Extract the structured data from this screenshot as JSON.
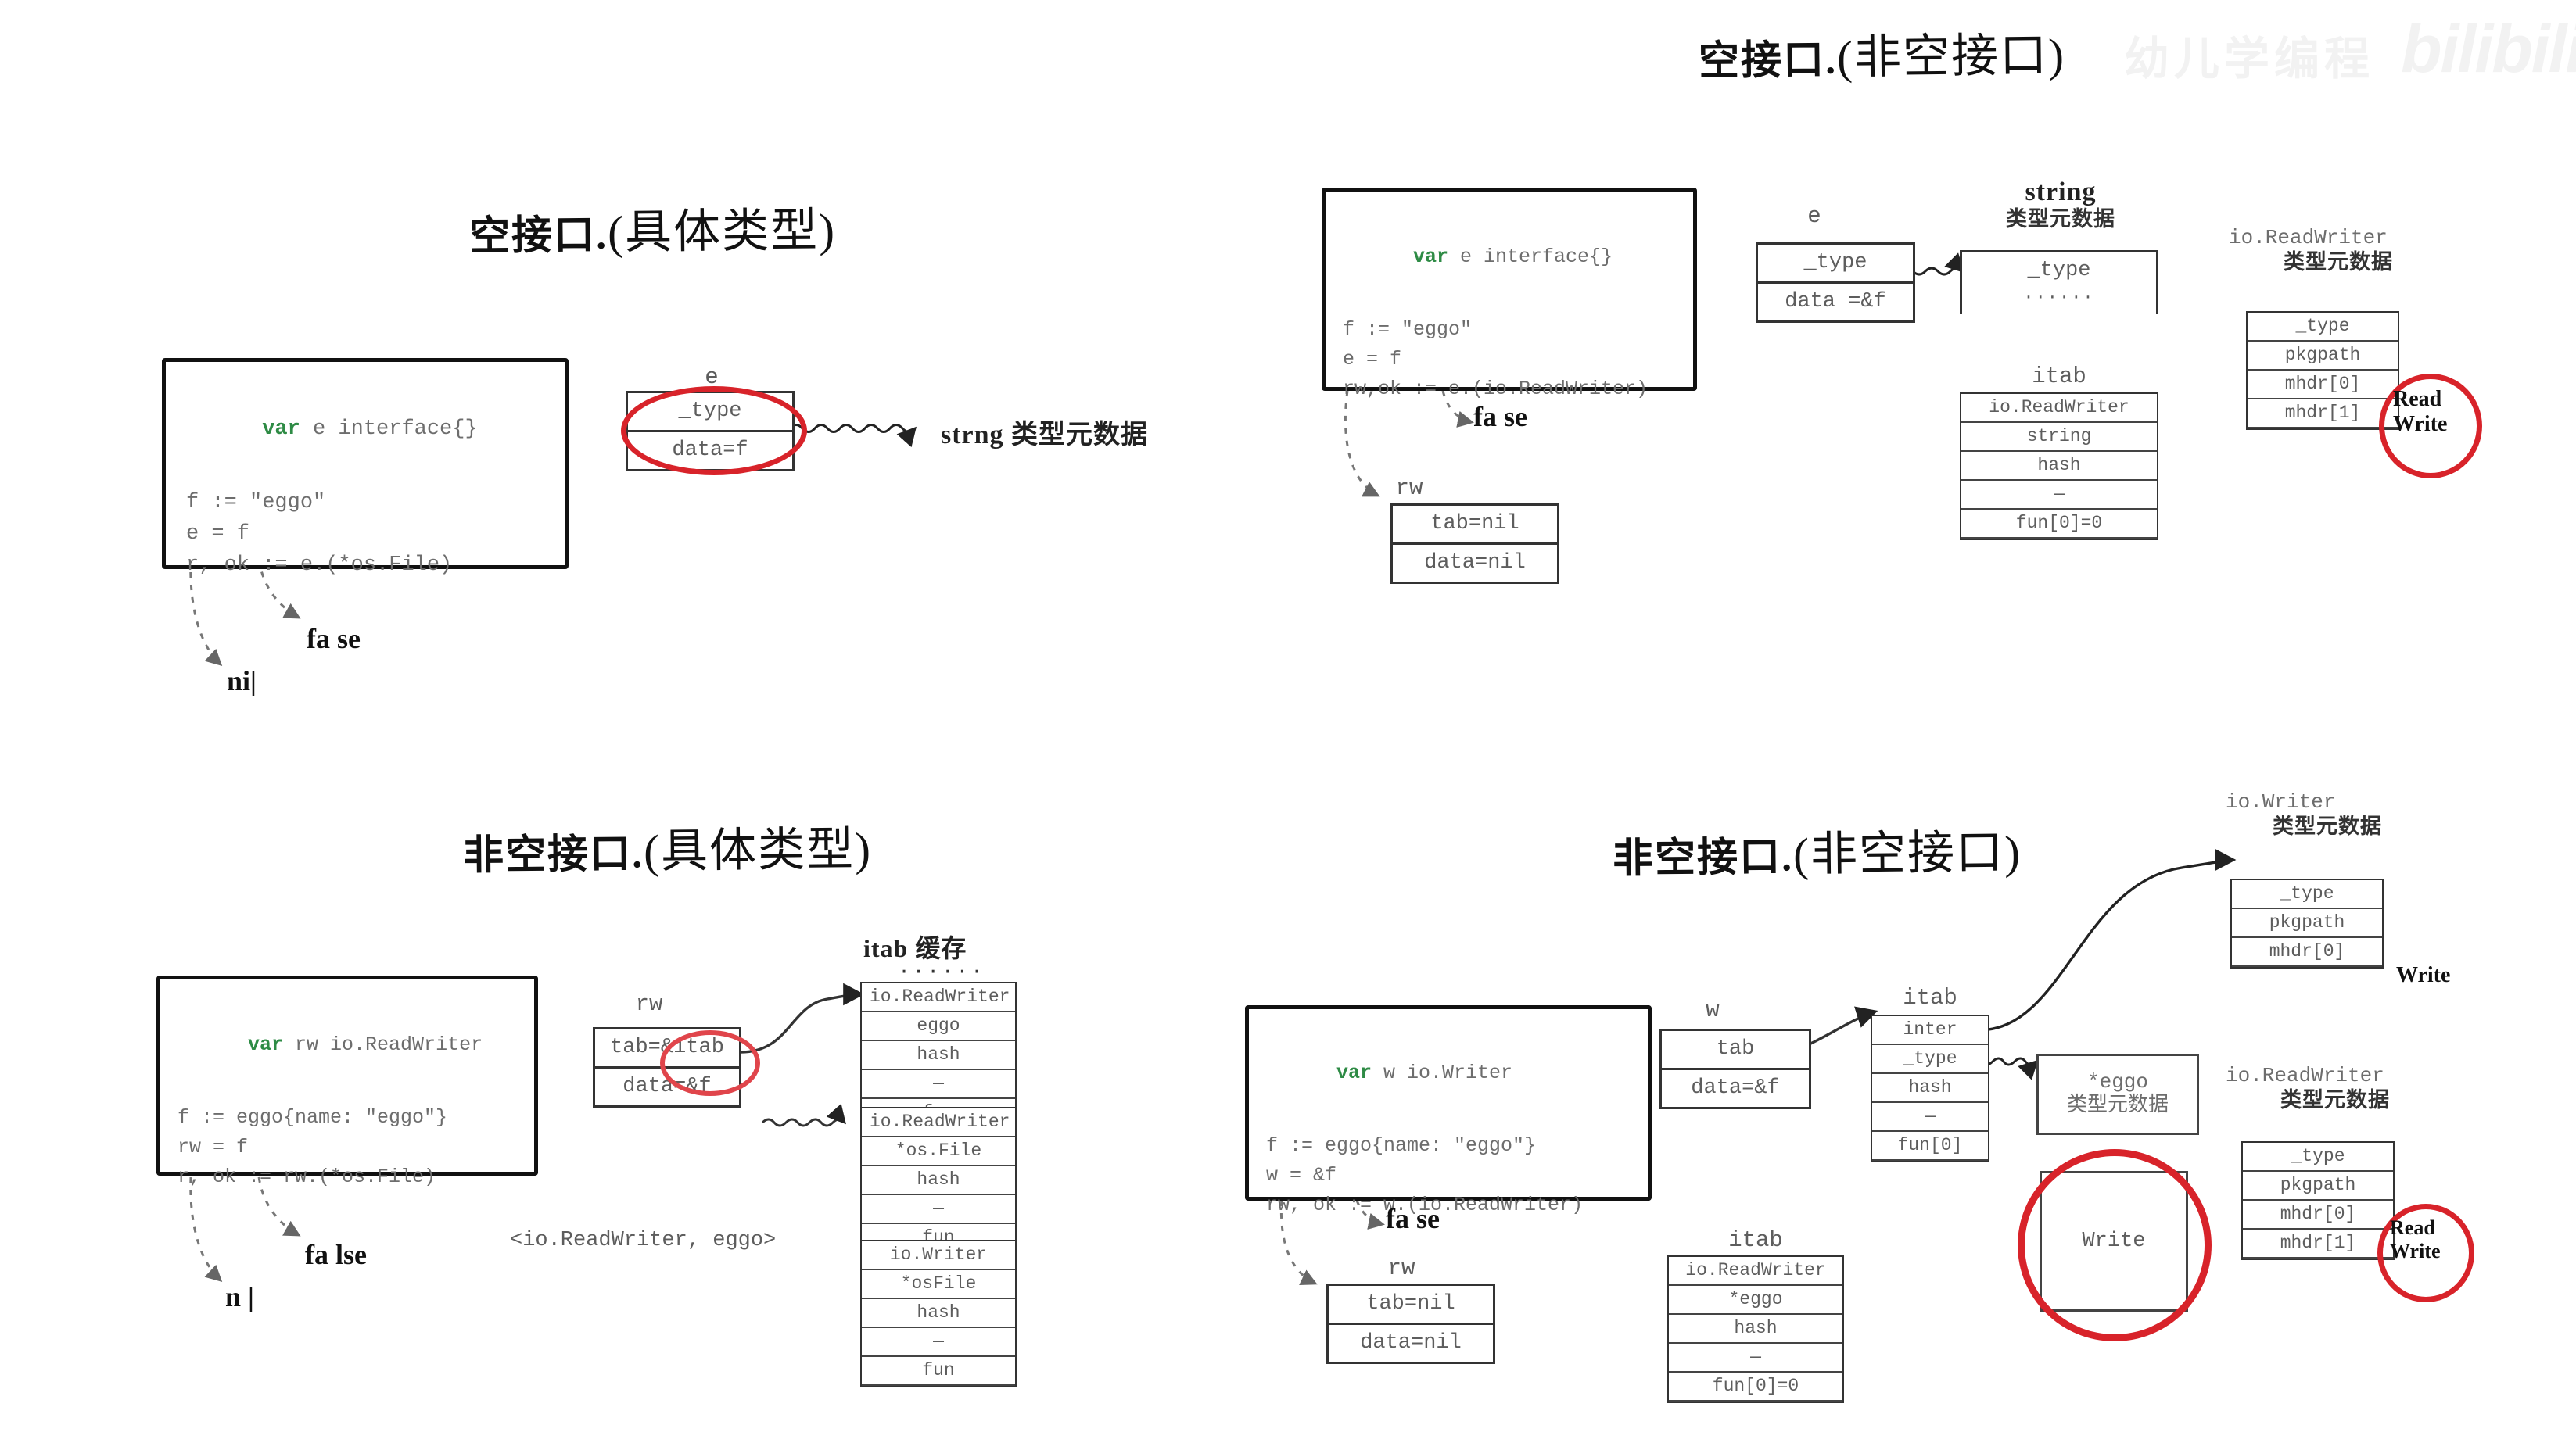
{
  "watermark": {
    "text_cn": "幼儿学编程",
    "brand": "bilibili"
  },
  "panels": {
    "top_left": {
      "title_main": "空接口.",
      "title_paren": "(具体类型)",
      "code": [
        {
          "kw": "var",
          "rest": " e interface{}"
        },
        {
          "kw": "",
          "rest": "f := \"eggo\""
        },
        {
          "kw": "",
          "rest": "e = f"
        },
        {
          "kw": "",
          "rest": "r, ok := e.(*os.File)"
        }
      ],
      "eface": {
        "label": "e",
        "rows": [
          "_type",
          "data=f"
        ]
      },
      "arrow_target": "strng 类型元数据",
      "annotations": [
        "fa se",
        "ni|"
      ]
    },
    "top_right": {
      "title_main": "空接口.",
      "title_paren": "(非空接口)",
      "code": [
        {
          "kw": "var",
          "rest": " e interface{}"
        },
        {
          "kw": "",
          "rest": "f := \"eggo\""
        },
        {
          "kw": "",
          "rest": "e = f"
        },
        {
          "kw": "",
          "rest": "rw,ok := e.(io.ReadWriter)"
        }
      ],
      "eface": {
        "label": "e",
        "rows": [
          "_type",
          "data =&f"
        ]
      },
      "string_meta": {
        "title_en": "string",
        "title_cn": "类型元数据",
        "rows": [
          "_type",
          "······"
        ]
      },
      "itab": {
        "label": "itab",
        "rows": [
          "io.ReadWriter",
          "string",
          "hash",
          "—",
          "fun[0]=0"
        ]
      },
      "rw_iface": {
        "label": "rw",
        "rows": [
          "tab=nil",
          "data=nil"
        ]
      },
      "readwriter_meta": {
        "title_en": "io.ReadWriter",
        "title_cn": "类型元数据",
        "rows": [
          "_type",
          "pkgpath",
          "mhdr[0]",
          "mhdr[1]"
        ],
        "circle_text_1": "Read",
        "circle_text_2": "Write"
      },
      "annotations": [
        "fa se"
      ]
    },
    "bottom_left": {
      "title_main": "非空接口.",
      "title_paren": "(具体类型)",
      "code": [
        {
          "kw": "var",
          "rest": " rw io.ReadWriter"
        },
        {
          "kw": "",
          "rest": "f := eggo{name: \"eggo\"}"
        },
        {
          "kw": "",
          "rest": "rw = f"
        },
        {
          "kw": "",
          "rest": "r, ok := rw.(*os.File)"
        }
      ],
      "iface": {
        "label": "rw",
        "rows": [
          "tab=&itab",
          "data=&f"
        ]
      },
      "circled_token": "&itab",
      "itab_cache_title": "itab 缓存",
      "itab_cache_dots": "······",
      "itab_cache": [
        {
          "rows": [
            "io.ReadWriter",
            "eggo",
            "hash",
            "—",
            "fun"
          ]
        },
        {
          "rows": [
            "io.ReadWriter",
            "*os.File",
            "hash",
            "—",
            "fun"
          ]
        },
        {
          "rows": [
            "io.Writer",
            "*osFile",
            "hash",
            "—",
            "fun"
          ]
        }
      ],
      "key_note": "<io.ReadWriter,  eggo>",
      "annotations": [
        "fa lse",
        "n |"
      ]
    },
    "bottom_right": {
      "title_main": "非空接口.",
      "title_paren": "(非空接口)",
      "code": [
        {
          "kw": "var",
          "rest": " w io.Writer"
        },
        {
          "kw": "",
          "rest": "f := eggo{name: \"eggo\"}"
        },
        {
          "kw": "",
          "rest": "w = &f"
        },
        {
          "kw": "",
          "rest": "rw, ok := w.(io.ReadWriter)"
        }
      ],
      "w_iface": {
        "label": "w",
        "rows": [
          "tab",
          "data=&f"
        ]
      },
      "itab_top": {
        "label": "itab",
        "rows": [
          "inter",
          "_type",
          "hash",
          "—",
          "fun[0]"
        ]
      },
      "writer_meta": {
        "title_en": "io.Writer",
        "title_cn": "类型元数据",
        "rows": [
          "_type",
          "pkgpath",
          "mhdr[0]"
        ],
        "side_text": "Write"
      },
      "eggo_meta": {
        "title_en": "*eggo",
        "title_cn": "类型元数据"
      },
      "write_box": {
        "text": "Write"
      },
      "itab_bottom": {
        "label": "itab",
        "rows": [
          "io.ReadWriter",
          "*eggo",
          "hash",
          "—",
          "fun[0]=0"
        ]
      },
      "readwriter_meta": {
        "title_en": "io.ReadWriter",
        "title_cn": "类型元数据",
        "rows": [
          "_type",
          "pkgpath",
          "mhdr[0]",
          "mhdr[1]"
        ],
        "circle_text_1": "Read",
        "circle_text_2": "Write"
      },
      "annotations": [
        "fa se"
      ]
    }
  },
  "colors": {
    "keyword_green": "#2e8b45",
    "highlight_red": "#d8232a",
    "ink": "#5d5d5d"
  }
}
